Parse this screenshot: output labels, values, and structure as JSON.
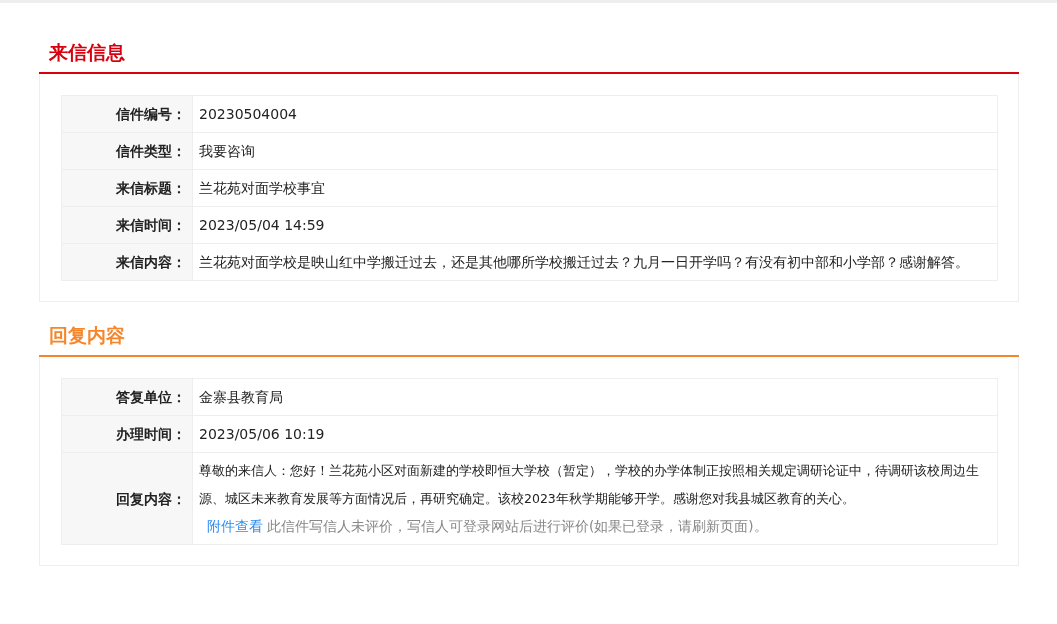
{
  "sections": [
    {
      "title": "来信信息",
      "color": "#d7000f",
      "rows": [
        {
          "label": "信件编号：",
          "value": "20230504004"
        },
        {
          "label": "信件类型：",
          "value": "我要咨询"
        },
        {
          "label": "来信标题：",
          "value": "兰花苑对面学校事宜"
        },
        {
          "label": "来信时间：",
          "value": "2023/05/04 14:59"
        },
        {
          "label": "来信内容：",
          "value": "兰花苑对面学校是映山红中学搬迁过去，还是其他哪所学校搬迁过去？九月一日开学吗？有没有初中部和小学部？感谢解答。"
        }
      ]
    },
    {
      "title": "回复内容",
      "color": "#f5862b",
      "rows": [
        {
          "label": "答复单位：",
          "value": "金寨县教育局"
        },
        {
          "label": "办理时间：",
          "value": "2023/05/06 10:19"
        },
        {
          "label": "回复内容：",
          "value": "尊敬的来信人：您好！兰花苑小区对面新建的学校即恒大学校（暂定），学校的办学体制正按照相关规定调研论证中，待调研该校周边生源、城区未来教育发展等方面情况后，再研究确定。该校2023年秋学期能够开学。感谢您对我县城区教育的关心。",
          "link": "附件查看",
          "note": "此信件写信人未评价，写信人可登录网站后进行评价(如果已登录，请刷新页面)。"
        }
      ]
    }
  ]
}
